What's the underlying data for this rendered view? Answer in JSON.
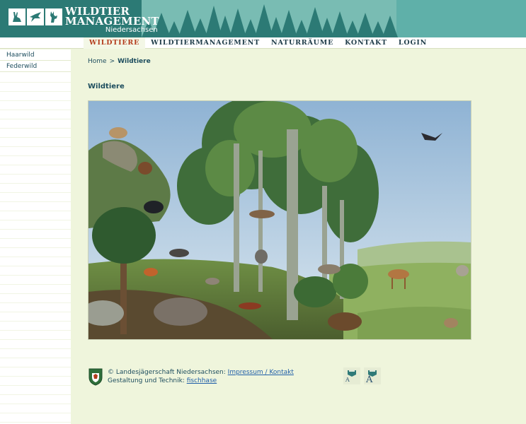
{
  "header": {
    "logo_line1": "WILDTIER",
    "logo_line2": "MANAGEMENT",
    "logo_line3": "Niedersachsen"
  },
  "nav": {
    "items": [
      {
        "label": "WILDTIERE",
        "active": true
      },
      {
        "label": "WILDTIERMANAGEMENT",
        "active": false
      },
      {
        "label": "NATURRÄUME",
        "active": false
      },
      {
        "label": "KONTAKT",
        "active": false
      },
      {
        "label": "LOGIN",
        "active": false
      }
    ]
  },
  "sidebar": {
    "items": [
      {
        "label": "Haarwild"
      },
      {
        "label": "Federwild"
      }
    ]
  },
  "breadcrumb": {
    "home": "Home",
    "separator": ">",
    "current": "Wildtiere"
  },
  "main": {
    "title": "Wildtiere"
  },
  "footer": {
    "copyright_prefix": "© Landesjägerschaft Niedersachsen:",
    "impressum_link": "Impressum / Kontakt",
    "design_prefix": "Gestaltung und Technik:",
    "design_link": "fischhase",
    "font_small_glyph": "A",
    "font_large_glyph": "A"
  },
  "colors": {
    "header_bg": "#2c7a75",
    "nav_active": "#b33b1c",
    "text_dark": "#1d4d5e",
    "link": "#1f5ea8",
    "page_bg": "#eff5dc"
  }
}
